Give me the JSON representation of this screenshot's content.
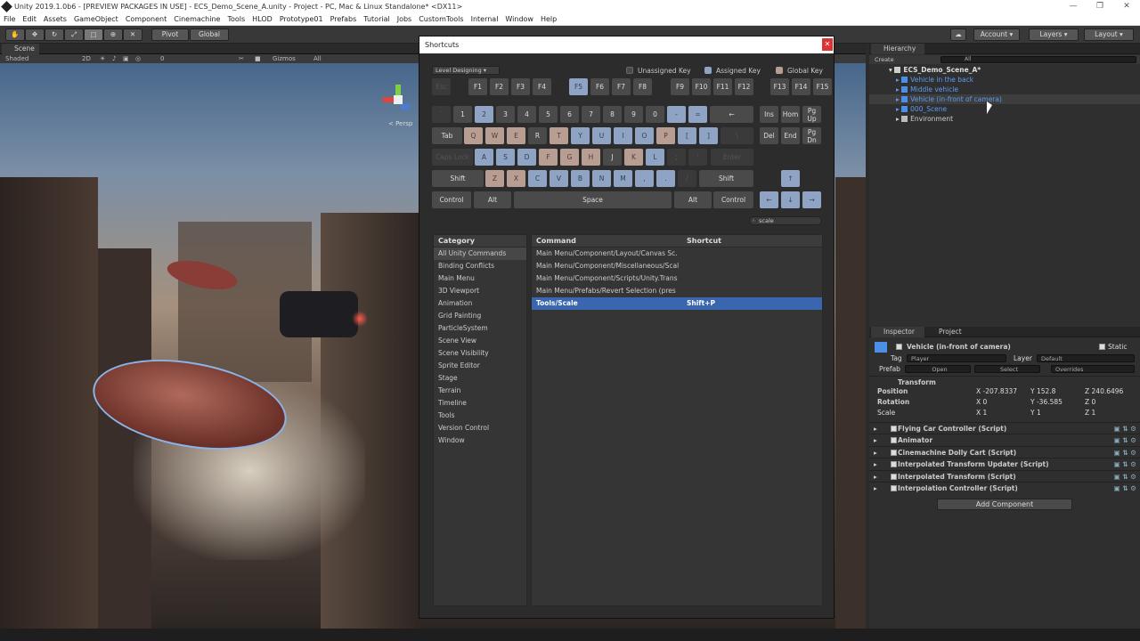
{
  "window": {
    "title": "Unity 2019.1.0b6 - [PREVIEW PACKAGES IN USE] - ECS_Demo_Scene_A.unity - Project - PC, Mac & Linux Standalone* <DX11>",
    "minimize": "—",
    "maximize": "❐",
    "close": "✕"
  },
  "menu": [
    "File",
    "Edit",
    "Assets",
    "GameObject",
    "Component",
    "Cinemachine",
    "Tools",
    "HLOD",
    "Prototype01",
    "Prefabs",
    "Tutorial",
    "Jobs",
    "CustomTools",
    "Internal",
    "Window",
    "Help"
  ],
  "toolbar": {
    "pivot": "Pivot",
    "global": "Global",
    "account": "Account",
    "layers": "Layers",
    "layout": "Layout"
  },
  "scene": {
    "tab": "Scene",
    "shading": "Shaded",
    "mode_2d": "2D",
    "gizmos": "Gizmos",
    "search_all": "All",
    "persp": "< Persp",
    "fx_count": "0"
  },
  "shortcuts": {
    "title": "Shortcuts",
    "profile": "Level Designing",
    "legend": {
      "unassigned": "Unassigned Key",
      "assigned": "Assigned Key",
      "global": "Global Key"
    },
    "search": "scale",
    "category_header": "Category",
    "categories": [
      "All Unity Commands",
      "Binding Conflicts",
      "Main Menu",
      "3D Viewport",
      "Animation",
      "Grid Painting",
      "ParticleSystem",
      "Scene View",
      "Scene Visibility",
      "Sprite Editor",
      "Stage",
      "Terrain",
      "Timeline",
      "Tools",
      "Version Control",
      "Window"
    ],
    "command_header": "Command",
    "shortcut_header": "Shortcut",
    "commands": [
      {
        "command": "Main Menu/Component/Layout/Canvas Sc.",
        "shortcut": ""
      },
      {
        "command": "Main Menu/Component/Miscellaneous/Scal",
        "shortcut": ""
      },
      {
        "command": "Main Menu/Component/Scripts/Unity.Trans",
        "shortcut": ""
      },
      {
        "command": "Main Menu/Prefabs/Revert Selection (pres",
        "shortcut": ""
      },
      {
        "command": "Tools/Scale",
        "shortcut": "Shift+P"
      }
    ],
    "keys": {
      "fn": [
        "Esc",
        "F1",
        "F2",
        "F3",
        "F4",
        "F5",
        "F6",
        "F7",
        "F8",
        "F9",
        "F10",
        "F11",
        "F12",
        "F13",
        "F14",
        "F15"
      ],
      "num": [
        "`",
        "1",
        "2",
        "3",
        "4",
        "5",
        "6",
        "7",
        "8",
        "9",
        "0",
        "-",
        "=",
        "←"
      ],
      "top": [
        "Tab",
        "Q",
        "W",
        "E",
        "R",
        "T",
        "Y",
        "U",
        "I",
        "O",
        "P",
        "[",
        "]",
        "\\"
      ],
      "home": [
        "Caps Lock",
        "A",
        "S",
        "D",
        "F",
        "G",
        "H",
        "J",
        "K",
        "L",
        ";",
        "'",
        "Enter"
      ],
      "shift": [
        "Shift",
        "Z",
        "X",
        "C",
        "V",
        "B",
        "N",
        "M",
        ",",
        ".",
        "/",
        "Shift"
      ],
      "bottom": [
        "Control",
        "Alt",
        "Space",
        "Alt",
        "Control"
      ],
      "nav": [
        "Ins",
        "Hom",
        "Pg Up",
        "Del",
        "End",
        "Pg Dn"
      ],
      "arrows": [
        "↑",
        "←",
        "↓",
        "→"
      ]
    }
  },
  "hierarchy": {
    "tab": "Hierarchy",
    "create": "Create",
    "search": "All",
    "scene": "ECS_Demo_Scene_A*",
    "items": [
      "Vehicle in the back",
      "Middle vehicle",
      "Vehicle (in-front of camera)",
      "000_Scene",
      "Environment"
    ]
  },
  "inspector": {
    "tab_inspector": "Inspector",
    "tab_project": "Project",
    "object": "Vehicle (in-front of camera)",
    "static": "Static",
    "tag_label": "Tag",
    "tag": "Player",
    "layer_label": "Layer",
    "layer": "Default",
    "prefab_label": "Prefab",
    "open": "Open",
    "select": "Select",
    "overrides": "Overrides",
    "transform": "Transform",
    "position_label": "Position",
    "rotation_label": "Rotation",
    "scale_label": "Scale",
    "position": {
      "x": "X -207.8337",
      "y": "Y 152.8",
      "z": "Z 240.6496"
    },
    "rotation": {
      "x": "X 0",
      "y": "Y -36.585",
      "z": "Z 0"
    },
    "scale": {
      "x": "X 1",
      "y": "Y 1",
      "z": "Z 1"
    },
    "components": [
      "Flying Car Controller (Script)",
      "Animator",
      "Cinemachine Dolly Cart (Script)",
      "Interpolated Transform Updater (Script)",
      "Interpolated Transform (Script)",
      "Interpolation Controller (Script)"
    ],
    "add_component": "Add Component"
  },
  "colors": {
    "assigned": "#8fa3c4",
    "global": "#b89d92",
    "selection": "#3a66b0",
    "hier_link": "#5c9cf0"
  }
}
